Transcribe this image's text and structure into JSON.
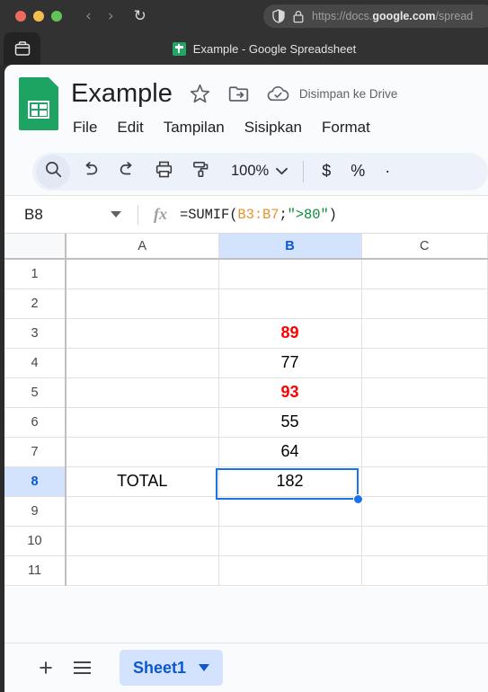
{
  "browser": {
    "traffic_lights": [
      "close",
      "minimize",
      "maximize"
    ],
    "back_label": "‹",
    "forward_label": "›",
    "reload_label": "↻",
    "url_prefix": "https://docs.",
    "url_domain": "google.com",
    "url_suffix": "/spread",
    "tab_title": "Example - Google Spreadsheet"
  },
  "header": {
    "doc_title": "Example",
    "save_status": "Disimpan ke Drive",
    "menu_items": [
      {
        "label": "File"
      },
      {
        "label": "Edit"
      },
      {
        "label": "Tampilan"
      },
      {
        "label": "Sisipkan"
      },
      {
        "label": "Format"
      }
    ]
  },
  "toolbar": {
    "zoom_level": "100%",
    "currency_label": "$",
    "percent_label": "%",
    "overflow_label": "·"
  },
  "formula_bar": {
    "name_box": "B8",
    "fx_label": "fx",
    "formula_prefix": "=SUMIF(",
    "formula_range": "B3:B7",
    "formula_separator": ";",
    "formula_criteria": "\">80\"",
    "formula_suffix": ")"
  },
  "grid": {
    "columns": [
      "A",
      "B",
      "C"
    ],
    "selected_column": "B",
    "selected_row": "8",
    "selected_cell": "B8",
    "rows": [
      {
        "num": "1",
        "a": "",
        "b": "",
        "c": "",
        "b_highlight": false
      },
      {
        "num": "2",
        "a": "",
        "b": "",
        "c": "",
        "b_highlight": false
      },
      {
        "num": "3",
        "a": "",
        "b": "89",
        "c": "",
        "b_highlight": true
      },
      {
        "num": "4",
        "a": "",
        "b": "77",
        "c": "",
        "b_highlight": false
      },
      {
        "num": "5",
        "a": "",
        "b": "93",
        "c": "",
        "b_highlight": true
      },
      {
        "num": "6",
        "a": "",
        "b": "55",
        "c": "",
        "b_highlight": false
      },
      {
        "num": "7",
        "a": "",
        "b": "64",
        "c": "",
        "b_highlight": false
      },
      {
        "num": "8",
        "a": "TOTAL",
        "b": "182",
        "c": "",
        "b_highlight": false
      },
      {
        "num": "9",
        "a": "",
        "b": "",
        "c": "",
        "b_highlight": false
      },
      {
        "num": "10",
        "a": "",
        "b": "",
        "c": "",
        "b_highlight": false
      },
      {
        "num": "11",
        "a": "",
        "b": "",
        "c": "",
        "b_highlight": false
      }
    ]
  },
  "sheetbar": {
    "add_sheet_label": "+",
    "active_sheet": "Sheet1"
  },
  "colors": {
    "accent": "#1a73e8",
    "selection_header": "#d3e3fd",
    "highlight_text": "#ff0000",
    "sheets_green": "#1da462",
    "formula_ref": "#e8912d",
    "formula_string": "#0f8a35"
  }
}
